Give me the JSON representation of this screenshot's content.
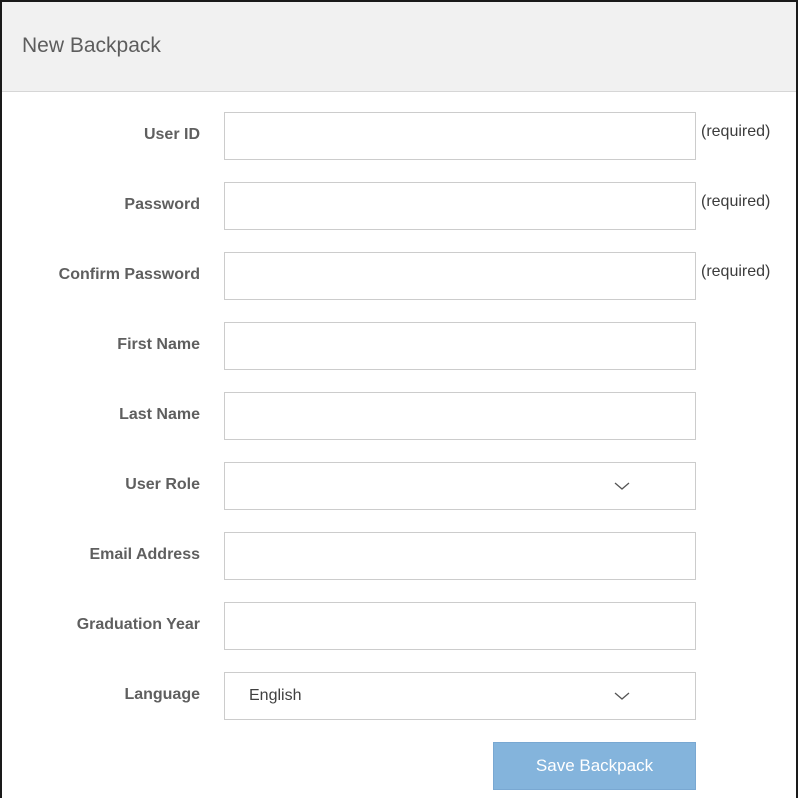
{
  "header": {
    "title": "New Backpack"
  },
  "form": {
    "fields": [
      {
        "label": "User ID",
        "value": "",
        "note": "(required)"
      },
      {
        "label": "Password",
        "value": "",
        "note": "(required)"
      },
      {
        "label": "Confirm Password",
        "value": "",
        "note": "(required)"
      },
      {
        "label": "First Name",
        "value": ""
      },
      {
        "label": "Last Name",
        "value": ""
      },
      {
        "label": "User Role",
        "value": "",
        "icon": "chevron-down-icon"
      },
      {
        "label": "Email Address",
        "value": ""
      },
      {
        "label": "Graduation Year",
        "value": ""
      },
      {
        "label": "Language",
        "value": "English",
        "icon": "chevron-down-icon"
      }
    ],
    "save_label": "Save Backpack"
  },
  "colors": {
    "header_bg": "#f1f1f1",
    "label_text": "#5f5f5f",
    "button_bg": "#84b4dc",
    "button_text": "#ffffff",
    "border": "#cccccc"
  }
}
